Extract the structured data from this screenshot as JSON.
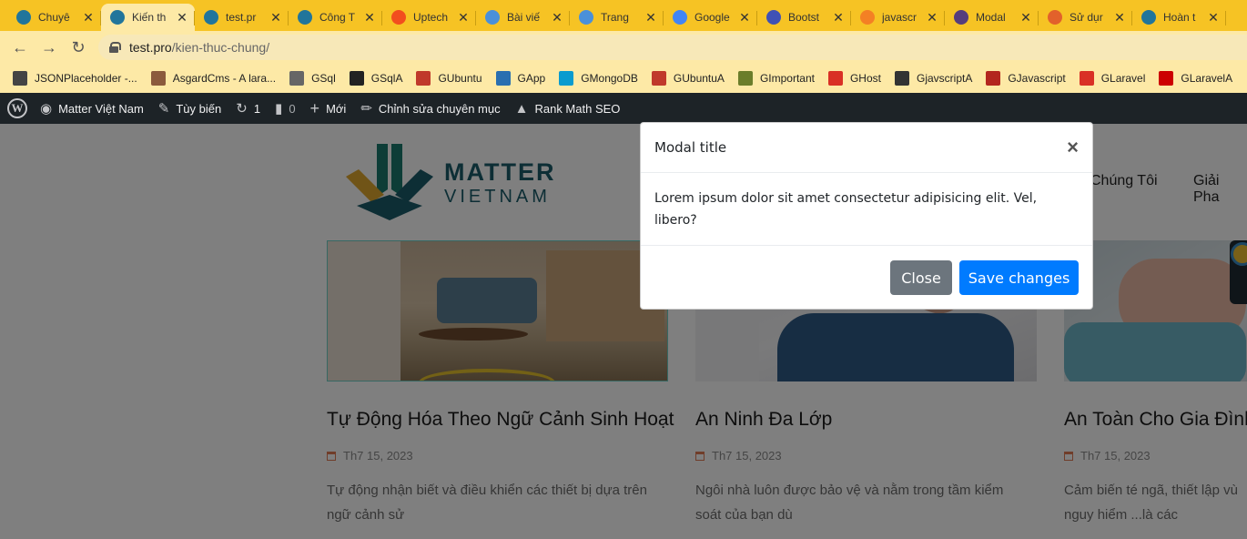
{
  "browser": {
    "tabs": [
      {
        "title": "Chuyê",
        "icon": "wordpress-icon",
        "color": "#21759b"
      },
      {
        "title": "Kiến th",
        "icon": "wordpress-icon",
        "color": "#21759b",
        "active": true
      },
      {
        "title": "test.pr",
        "icon": "wordpress-icon",
        "color": "#21759b"
      },
      {
        "title": "Công T",
        "icon": "wordpress-icon",
        "color": "#21759b"
      },
      {
        "title": "Uptech",
        "icon": "figma-icon",
        "color": "#f24e1e"
      },
      {
        "title": "Bài viế",
        "icon": "globe-icon",
        "color": "#4a90d9"
      },
      {
        "title": "Trang",
        "icon": "globe-icon",
        "color": "#4a90d9"
      },
      {
        "title": "Google",
        "icon": "google-translate-icon",
        "color": "#4285f4"
      },
      {
        "title": "Bootst",
        "icon": "mdb-icon",
        "color": "#3f51b5"
      },
      {
        "title": "javascr",
        "icon": "stackoverflow-icon",
        "color": "#f48024"
      },
      {
        "title": "Modal",
        "icon": "bootstrap-icon",
        "color": "#563d7c"
      },
      {
        "title": "Sử dụr",
        "icon": "svl-icon",
        "color": "#e2612b"
      },
      {
        "title": "Hoàn t",
        "icon": "wordpress-icon",
        "color": "#21759b"
      }
    ],
    "url_host": "test.pro",
    "url_path": "/kien-thuc-chung/",
    "bookmarks": [
      {
        "label": "JSONPlaceholder -...",
        "icon": "jsonplaceholder-icon",
        "color": "#444"
      },
      {
        "label": "AsgardCms - A lara...",
        "icon": "asgard-icon",
        "color": "#8b5a3c"
      },
      {
        "label": "GSql",
        "icon": "sql-icon",
        "color": "#666"
      },
      {
        "label": "GSqlA",
        "icon": "globe-icon",
        "color": "#222"
      },
      {
        "label": "GUbuntu",
        "icon": "ubuntu-icon",
        "color": "#c0392b"
      },
      {
        "label": "GApp",
        "icon": "cafsa-icon",
        "color": "#2a6fb0"
      },
      {
        "label": "GMongoDB",
        "icon": "mongodb-icon",
        "color": "#0a9bcf"
      },
      {
        "label": "GUbuntuA",
        "icon": "ubuntu-icon",
        "color": "#c0392b"
      },
      {
        "label": "GImportant",
        "icon": "important-icon",
        "color": "#6b7d2a"
      },
      {
        "label": "GHost",
        "icon": "plane-icon",
        "color": "#d93025"
      },
      {
        "label": "GjavscriptA",
        "icon": "pen-icon",
        "color": "#333"
      },
      {
        "label": "GJavascript",
        "icon": "js-icon",
        "color": "#b3261e"
      },
      {
        "label": "GLaravel",
        "icon": "pin-icon",
        "color": "#d93025"
      },
      {
        "label": "GLaravelA",
        "icon": "cnn-icon",
        "color": "#cc0000"
      }
    ]
  },
  "adminbar": {
    "site_name": "Matter Việt Nam",
    "customize": "Tùy biến",
    "updates_count": "1",
    "comments_count": "0",
    "new": "Mới",
    "edit_category": "Chỉnh sửa chuyên mục",
    "rank_math": "Rank Math SEO"
  },
  "site": {
    "logo_word1": "MATTER",
    "logo_word2": "VIETNAM",
    "nav": [
      "Chúng Tôi",
      "Giải Pha"
    ],
    "posts": [
      {
        "title": "Tự Động Hóa Theo Ngữ Cảnh Sinh Hoạt",
        "date": "Th7 15, 2023",
        "excerpt1": "Tự động nhận biết và điều khiển các thiết bị dựa trên",
        "excerpt2": "ngữ cảnh sử"
      },
      {
        "title": "An Ninh Đa Lớp",
        "date": "Th7 15, 2023",
        "excerpt1": "Ngôi nhà luôn được bảo vệ và nằm trong tầm kiểm",
        "excerpt2": "soát của bạn dù"
      },
      {
        "title": "An Toàn Cho Gia Đình",
        "date": "Th7 15, 2023",
        "excerpt1": "Cảm biến té ngã, thiết lập vù",
        "excerpt2": "nguy hiểm ...là các"
      }
    ]
  },
  "modal": {
    "title": "Modal title",
    "close_symbol": "×",
    "body": "Lorem ipsum dolor sit amet consectetur adipisicing elit. Vel, libero?",
    "close_label": "Close",
    "save_label": "Save changes"
  }
}
